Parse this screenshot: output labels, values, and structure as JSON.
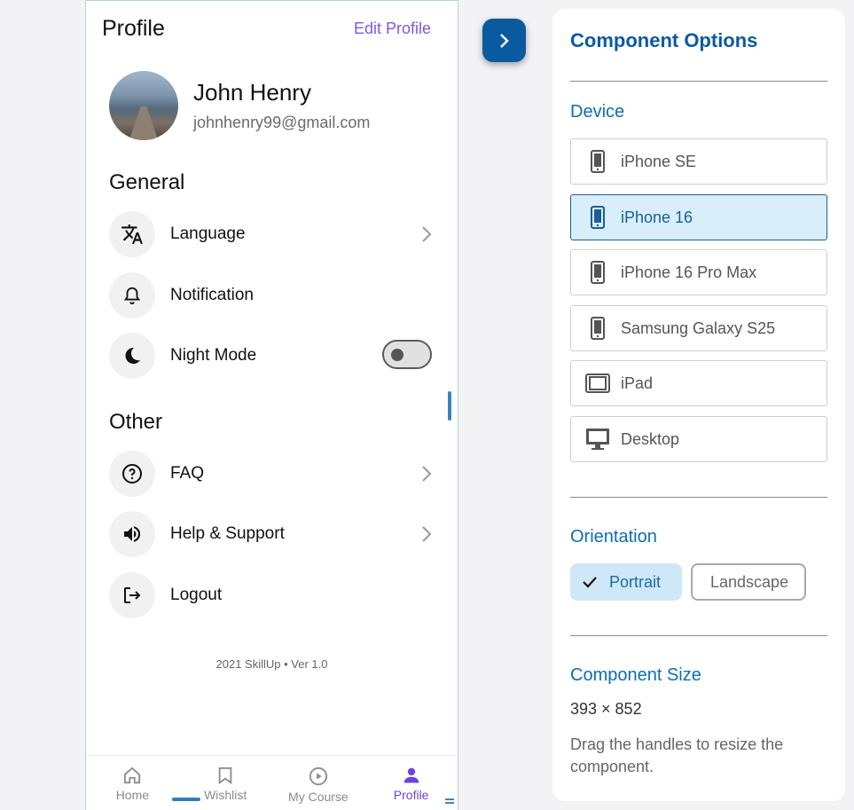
{
  "profile": {
    "title": "Profile",
    "edit_label": "Edit Profile",
    "name": "John Henry",
    "email": "johnhenry99@gmail.com"
  },
  "general": {
    "heading": "General",
    "items": [
      {
        "label": "Language",
        "icon": "translate-icon"
      },
      {
        "label": "Notification",
        "icon": "bell-icon"
      },
      {
        "label": "Night Mode",
        "icon": "moon-icon",
        "toggle": false
      }
    ]
  },
  "other": {
    "heading": "Other",
    "items": [
      {
        "label": "FAQ",
        "icon": "question-icon"
      },
      {
        "label": "Help & Support",
        "icon": "speaker-icon"
      },
      {
        "label": "Logout",
        "icon": "logout-icon"
      }
    ]
  },
  "footer": {
    "version": "2021 SkillUp • Ver 1.0"
  },
  "tabs": [
    {
      "label": "Home",
      "icon": "home-icon"
    },
    {
      "label": "Wishlist",
      "icon": "bookmark-icon"
    },
    {
      "label": "My Course",
      "icon": "play-circle-icon"
    },
    {
      "label": "Profile",
      "icon": "person-icon",
      "active": true
    }
  ],
  "options": {
    "title": "Component Options",
    "device_heading": "Device",
    "devices": [
      {
        "label": "iPhone SE",
        "icon": "phone-icon"
      },
      {
        "label": "iPhone 16",
        "icon": "phone-icon",
        "selected": true
      },
      {
        "label": "iPhone 16 Pro Max",
        "icon": "phone-icon"
      },
      {
        "label": "Samsung Galaxy S25",
        "icon": "phone-icon"
      },
      {
        "label": "iPad",
        "icon": "tablet-icon"
      },
      {
        "label": "Desktop",
        "icon": "desktop-icon"
      }
    ],
    "orientation_heading": "Orientation",
    "portrait_label": "Portrait",
    "landscape_label": "Landscape",
    "size_heading": "Component Size",
    "size_value": "393 × 852",
    "size_hint": "Drag the handles to resize the component."
  },
  "colors": {
    "accent": "#0a5aa0",
    "edit": "#7a5ae6",
    "selected_bg": "#d8eefb"
  }
}
